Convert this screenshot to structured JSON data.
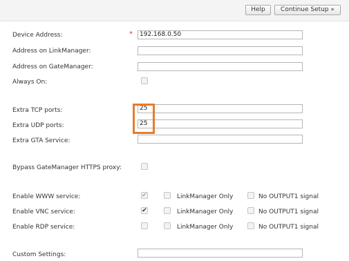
{
  "header": {
    "help_label": "Help",
    "continue_label": "Continue Setup »"
  },
  "colors": {
    "highlight": "#e57c2c",
    "required": "#e03030"
  },
  "form": {
    "device_address": {
      "label": "Device Address:",
      "required_mark": "*",
      "value": "192.168.0.50"
    },
    "address_linkmanager": {
      "label": "Address on LinkManager:",
      "value": ""
    },
    "address_gatemanager": {
      "label": "Address on GateManager:",
      "value": ""
    },
    "always_on": {
      "label": "Always On:",
      "checked": false
    },
    "extra_tcp": {
      "label": "Extra TCP ports:",
      "value": "25"
    },
    "extra_udp": {
      "label": "Extra UDP ports:",
      "value": "25"
    },
    "extra_gta": {
      "label": "Extra GTA Service:",
      "value": ""
    },
    "bypass_proxy": {
      "label": "Bypass GateManager HTTPS proxy:",
      "checked": false
    },
    "services": {
      "linkmanager_only_label": "LinkManager Only",
      "no_output_label": "No OUTPUT1 signal",
      "rows": [
        {
          "label": "Enable WWW service:",
          "enabled": true,
          "locked": true,
          "linkmanager_only": false,
          "no_output": false
        },
        {
          "label": "Enable VNC service:",
          "enabled": true,
          "locked": false,
          "linkmanager_only": false,
          "no_output": false
        },
        {
          "label": "Enable RDP service:",
          "enabled": false,
          "locked": false,
          "linkmanager_only": false,
          "no_output": false
        }
      ]
    },
    "custom_settings": {
      "label": "Custom Settings:",
      "value": ""
    }
  }
}
